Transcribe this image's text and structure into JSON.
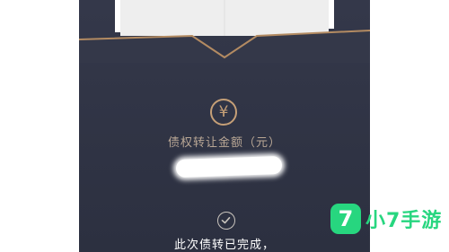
{
  "amount_section": {
    "currency_symbol": "¥",
    "label": "债权转让金额（元）"
  },
  "status": {
    "message": "此次债转已完成，"
  },
  "watermark": {
    "logo_glyph": "7",
    "text": "小7手游"
  },
  "colors": {
    "panel_dark": "#2f3344",
    "gold_accent": "#c59f77",
    "watermark_green": "#27d67f"
  }
}
